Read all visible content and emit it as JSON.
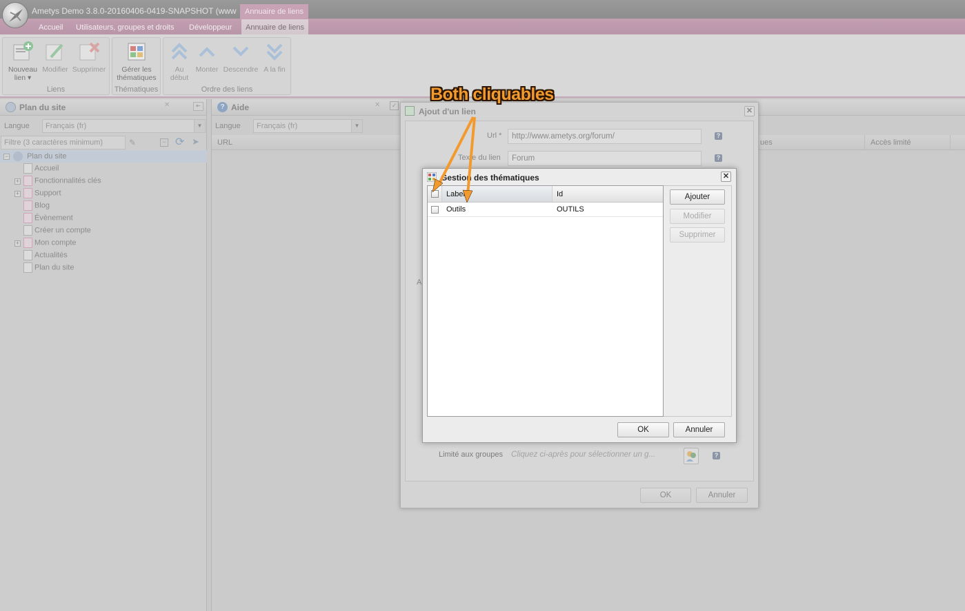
{
  "app": {
    "title": "Ametys Demo 3.8.0-20160406-0419-SNAPSHOT (www",
    "context_label": "Annuaire de liens"
  },
  "tabs": [
    "Accueil",
    "Utilisateurs, groupes et droits",
    "Développeur",
    "Annuaire de liens"
  ],
  "ribbon": {
    "groups": {
      "liens": "Liens",
      "thematiques": "Thématiques",
      "ordre": "Ordre des liens"
    },
    "buttons": {
      "nouveau": "Nouveau lien",
      "modifier": "Modifier",
      "supprimer": "Supprimer",
      "gerer": "Gérer les thématiques",
      "au_debut": "Au début",
      "monter": "Monter",
      "descendre": "Descendre",
      "a_la_fin": "A la fin"
    }
  },
  "sitemap_panel": {
    "title": "Plan du site",
    "langue_label": "Langue",
    "langue_value": "Français (fr)",
    "filter_placeholder": "Filtre (3 caractères minimum)",
    "root": "Plan du site",
    "items": [
      "Accueil",
      "Fonctionnalités clés",
      "Support",
      "Blog",
      "Évènement",
      "Créer un compte",
      "Mon compte",
      "Actualités",
      "Plan du site"
    ]
  },
  "aide_panel": {
    "title": "Aide",
    "langue_label": "Langue",
    "langue_value": "Français (fr)",
    "col_url": "URL",
    "col_ues": "ues",
    "col_acces": "Accès limité"
  },
  "ajout_dialog": {
    "title": "Ajout d'un lien",
    "url_label": "Url *",
    "url_value": "http://www.ametys.org/forum/",
    "texte_label": "Texte du lien",
    "texte_value": "Forum",
    "side_letter": "Al",
    "groupes_label": "Limité aux groupes",
    "groupes_placeholder": "Cliquez ci-après pour sélectionner un g...",
    "ok": "OK",
    "annuler": "Annuler"
  },
  "thematiques_dialog": {
    "title": "Gestion des thématiques",
    "col_label": "Label",
    "col_id": "Id",
    "rows": [
      {
        "label": "Outils",
        "id": "OUTILS"
      }
    ],
    "ajouter": "Ajouter",
    "modifier": "Modifier",
    "supprimer": "Supprimer",
    "ok": "OK",
    "annuler": "Annuler"
  },
  "annotation": {
    "text": "Both cliquables"
  },
  "colors": {
    "accent_pink": "#c39fb2",
    "annotation_orange": "#f39a2f"
  }
}
